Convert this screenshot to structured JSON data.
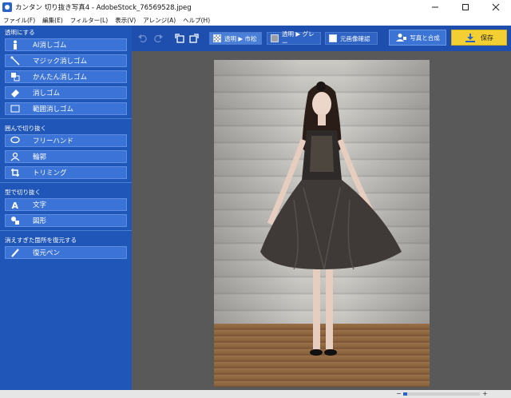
{
  "window": {
    "title": "カンタン 切り抜き写真4 - AdobeStock_76569528.jpeg"
  },
  "menu": [
    "ファイル(F)",
    "編集(E)",
    "フィルター(L)",
    "表示(V)",
    "アレンジ(A)",
    "ヘルプ(H)"
  ],
  "sidebar": {
    "sections": [
      {
        "title": "透明にする",
        "buttons": [
          {
            "label": "AI消しゴム",
            "icon": "person-icon"
          },
          {
            "label": "マジック消しゴム",
            "icon": "magic-wand-icon"
          },
          {
            "label": "かんたん消しゴム",
            "icon": "easy-eraser-icon"
          },
          {
            "label": "消しゴム",
            "icon": "eraser-icon"
          },
          {
            "label": "範囲消しゴム",
            "icon": "range-eraser-icon"
          }
        ]
      },
      {
        "title": "囲んで切り抜く",
        "buttons": [
          {
            "label": "フリーハンド",
            "icon": "lasso-icon"
          },
          {
            "label": "輪郭",
            "icon": "outline-icon"
          },
          {
            "label": "トリミング",
            "icon": "crop-icon"
          }
        ]
      },
      {
        "title": "型で切り抜く",
        "buttons": [
          {
            "label": "文字",
            "icon": "text-icon"
          },
          {
            "label": "図形",
            "icon": "shapes-icon"
          }
        ]
      },
      {
        "title": "消えすぎた箇所を復元する",
        "buttons": [
          {
            "label": "復元ペン",
            "icon": "pen-icon"
          }
        ]
      }
    ]
  },
  "toolbar": {
    "modes": [
      {
        "label": "透明 ▶ 市松",
        "active": true
      },
      {
        "label": "透明 ▶ グレー",
        "active": false
      },
      {
        "label": "元画像確認",
        "active": false
      }
    ],
    "compose_label": "写真と合成",
    "save_label": "保存"
  },
  "status": {
    "zoom_fraction": 0.05
  },
  "colors": {
    "sidebar": "#2056b8",
    "toolbar": "#1f4fae",
    "canvas": "#595959",
    "save": "#f3cf33"
  }
}
